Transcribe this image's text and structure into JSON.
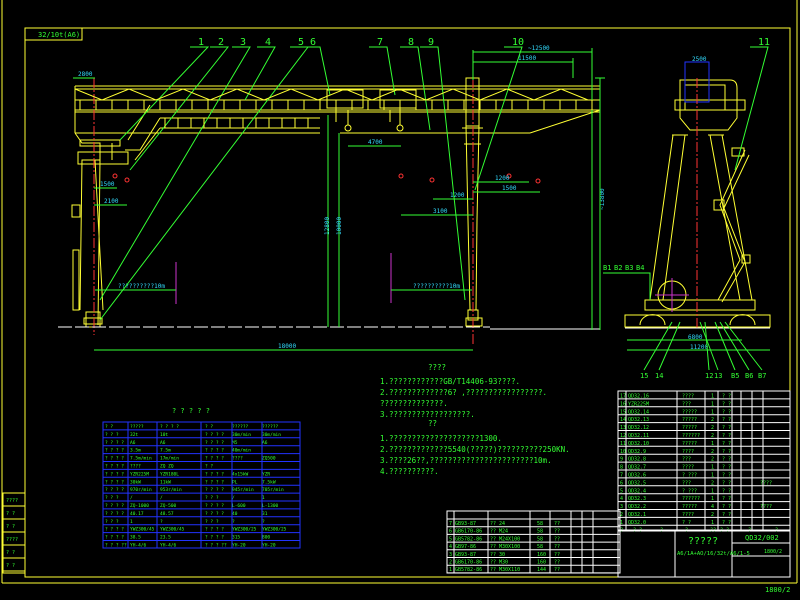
{
  "title_tag": "32/10t(A6)",
  "drawing_no": "1800/2",
  "part_callouts": [
    "1",
    "2",
    "3",
    "4",
    "5",
    "6",
    "7",
    "8",
    "9",
    "10",
    "11"
  ],
  "side_callouts_top": [
    "B1",
    "B2",
    "B3",
    "B4"
  ],
  "side_callouts_bottom": [
    "15",
    "14",
    "13",
    "12",
    "B5",
    "B6",
    "B7"
  ],
  "dimensions": {
    "left_overhang": "2800",
    "total_length": "~12500",
    "cantilever": "11500",
    "hook_gap": "4700",
    "span": "18000",
    "lift_height_1": "12800",
    "lift_height_2": "10000",
    "approach_1": "1500",
    "approach_2": "2100",
    "approach_3": "1200",
    "approach_4": "3100",
    "approach_5": "1200",
    "approach_6": "1500",
    "height_total": "~13800",
    "side_top": "2500",
    "side_base_1": "6800",
    "side_base_2": "11200",
    "lift_note": "??????????10m"
  },
  "notes": {
    "title": "????",
    "items": [
      "1.????????????GB/T14406-93????.",
      "2.?????????????6? ,?????????????????.",
      "  ??????????????.",
      "3.??????????????????."
    ],
    "title2": "??",
    "items2": [
      "1.????????????????????1300.",
      "2.?????????????5540(?????)??????????250KN.",
      "3.????26??,???????????????????????10m.",
      "4.??????????."
    ]
  },
  "spec_table": {
    "title": "? ? ? ? ?",
    "header": [
      "? ?",
      "?????",
      "? ? ? ?",
      "? ?",
      "??????",
      "??????"
    ],
    "rows": [
      [
        "? ? ?",
        "32t",
        "10t",
        "? ? ? ?",
        "30m/min",
        "30m/min"
      ],
      [
        "? ? ? ?",
        "A6",
        "A6",
        "? ? ? ?",
        "M5",
        "A6"
      ],
      [
        "? ? ? ?",
        "3.5m",
        "7.5m",
        "? ? ? ?",
        "40m/min",
        ""
      ],
      [
        "? ? ? ?",
        "7.5m/min",
        "17m/min",
        "? ? ? ?",
        "????",
        "ZQ500"
      ],
      [
        "? ? ? ?",
        "????",
        "ZQ ZQ",
        "? ?",
        "",
        ""
      ],
      [
        "? ? ? ?",
        "YZR225M",
        "YZR180L",
        "? ? ? ?",
        "4x15kW",
        "YZR"
      ],
      [
        "? ? ? ?",
        "30kW",
        "11kW",
        "? ? ? ?",
        "PL",
        "7.5kW"
      ],
      [
        "? ? ? ?",
        "970r/min",
        "953r/min",
        "? ? ? ?",
        "945r/min",
        "705r/min"
      ],
      [
        "? ? ?",
        "/",
        "/",
        "? ? ?",
        "/",
        "1"
      ],
      [
        "? ? ? ?",
        "ZQ-1000",
        "ZQ-500",
        "? ? ? ?",
        "L-600",
        "L-1300"
      ],
      [
        "? ? ? ?",
        "40.17",
        "48.57",
        "? ? ? ?",
        "40",
        "31"
      ],
      [
        "? ? ?",
        "1",
        "?",
        "? ? ?",
        "?",
        "?"
      ],
      [
        "? ? ? ?",
        "YWZ300/45",
        "YWZ300/45",
        "? ? ? ?",
        "YWZ300/25",
        "YWZ300/25"
      ],
      [
        "? ? ? ?",
        "38.5",
        "23.5",
        "? ? ? ?",
        "315",
        "800"
      ],
      [
        "? ? ? ??",
        "YH-4/6",
        "YH-4/6",
        "? ? ? ??",
        "YH-20",
        "YH-20"
      ]
    ]
  },
  "parts_table": {
    "header": [
      "?",
      "? ?",
      "?",
      "?",
      "??",
      "? ?",
      "?",
      "?"
    ],
    "rows": [
      [
        "17",
        "QD32.16",
        "????",
        "1",
        "? ?"
      ],
      [
        "16",
        "YZR225M",
        "???",
        "1",
        "? ?"
      ],
      [
        "15",
        "QD32.14",
        "?????",
        "1",
        "? ?"
      ],
      [
        "14",
        "QD32.13",
        "?????",
        "2",
        "? ?"
      ],
      [
        "13",
        "QD32.12",
        "?????",
        "2",
        "? ?"
      ],
      [
        "12",
        "QD32.11",
        "??????",
        "2",
        "? ?"
      ],
      [
        "11",
        "QD32.10",
        "?????",
        "1",
        "? ?"
      ],
      [
        "10",
        "QD32.9",
        "????",
        "2",
        "? ?"
      ],
      [
        "9",
        "QD32.8",
        "???",
        "2",
        "? ?"
      ],
      [
        "8",
        "QD32.7",
        "????",
        "1",
        "? ?"
      ],
      [
        "7",
        "QD32.6",
        "? ???",
        "1",
        "? ?"
      ],
      [
        "6",
        "QD32.5",
        "???",
        "2",
        "? ?",
        "????"
      ],
      [
        "5",
        "QD32.4",
        "? ???",
        "1",
        "? ?"
      ],
      [
        "4",
        "QD32.3",
        "??????",
        "1",
        "? ?"
      ],
      [
        "3",
        "QD32.2",
        "?????",
        "4",
        "? ?",
        "????"
      ],
      [
        "2",
        "QD32.1",
        "????",
        "2",
        "? ?"
      ],
      [
        "1",
        "QD32.0",
        "? ?",
        "1",
        "? ?"
      ]
    ]
  },
  "fastener_table": {
    "rows": [
      [
        "7",
        "GB93-87",
        "?? 24",
        "58",
        "??"
      ],
      [
        "6",
        "GB6170-86",
        "?? M24",
        "58",
        "??"
      ],
      [
        "5",
        "GB5782-86",
        "?? M24X100",
        "58",
        "??"
      ],
      [
        "4",
        "GB97-86",
        "?? M30X100",
        "58",
        "??"
      ],
      [
        "3",
        "GB93-87",
        "?? 30",
        "160",
        "??"
      ],
      [
        "2",
        "GB6170-86",
        "?? M30",
        "160",
        "??"
      ],
      [
        "1",
        "GB5782-86",
        "?? M30X110",
        "144",
        "??"
      ]
    ]
  },
  "title_block": {
    "name": "?????",
    "spec": "A6/1A+AO/16/32t/A6/1-5",
    "code": "QD32/002",
    "sheet": "1800/2"
  },
  "left_strip": [
    "????",
    "? ?",
    "? ?",
    "????",
    "? ?",
    "? ?"
  ],
  "colors": {
    "outline": "#ffff33",
    "dimension": "#33ff33",
    "centerline": "#ff3333",
    "text_dim": "#33ddff",
    "table_grid": "#2233ff",
    "background": "#000000"
  }
}
